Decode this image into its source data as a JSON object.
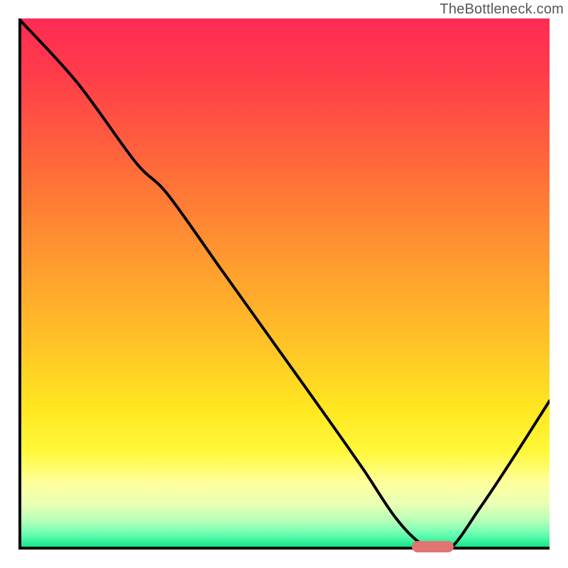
{
  "attribution": "TheBottleneck.com",
  "colors": {
    "gradient_top": "#ff2a54",
    "gradient_mid": "#ffc426",
    "gradient_yellow": "#fff83a",
    "gradient_green": "#12e785",
    "axis": "#000000",
    "curve": "#000000",
    "marker": "#e27373",
    "attribution_text": "#565656"
  },
  "chart_data": {
    "type": "line",
    "title": "",
    "xlabel": "",
    "ylabel": "",
    "xlim": [
      0,
      100
    ],
    "ylim": [
      0,
      100
    ],
    "grid": false,
    "legend": false,
    "series": [
      {
        "name": "bottleneck-curve",
        "x": [
          0,
          11,
          22,
          28,
          38,
          48,
          58,
          65,
          71,
          76,
          81,
          87,
          93,
          100
        ],
        "values": [
          100,
          88,
          73,
          67,
          53,
          39,
          25,
          15,
          6,
          1,
          0,
          8,
          17,
          28
        ]
      }
    ],
    "marker": {
      "x_start": 74,
      "x_end": 82,
      "y": 0
    },
    "gradient_stops": [
      {
        "pct": 0,
        "hex": "#ff2a54"
      },
      {
        "pct": 10,
        "hex": "#ff3b4b"
      },
      {
        "pct": 22,
        "hex": "#ff5a3f"
      },
      {
        "pct": 35,
        "hex": "#ff7d35"
      },
      {
        "pct": 48,
        "hex": "#ffa02e"
      },
      {
        "pct": 62,
        "hex": "#ffc426"
      },
      {
        "pct": 74,
        "hex": "#ffe720"
      },
      {
        "pct": 82,
        "hex": "#fff83a"
      },
      {
        "pct": 88,
        "hex": "#ffff9f"
      },
      {
        "pct": 92,
        "hex": "#e9ffb5"
      },
      {
        "pct": 95,
        "hex": "#b6ffb6"
      },
      {
        "pct": 97,
        "hex": "#7dffb4"
      },
      {
        "pct": 98.5,
        "hex": "#49f7a7"
      },
      {
        "pct": 100,
        "hex": "#12e785"
      }
    ]
  }
}
